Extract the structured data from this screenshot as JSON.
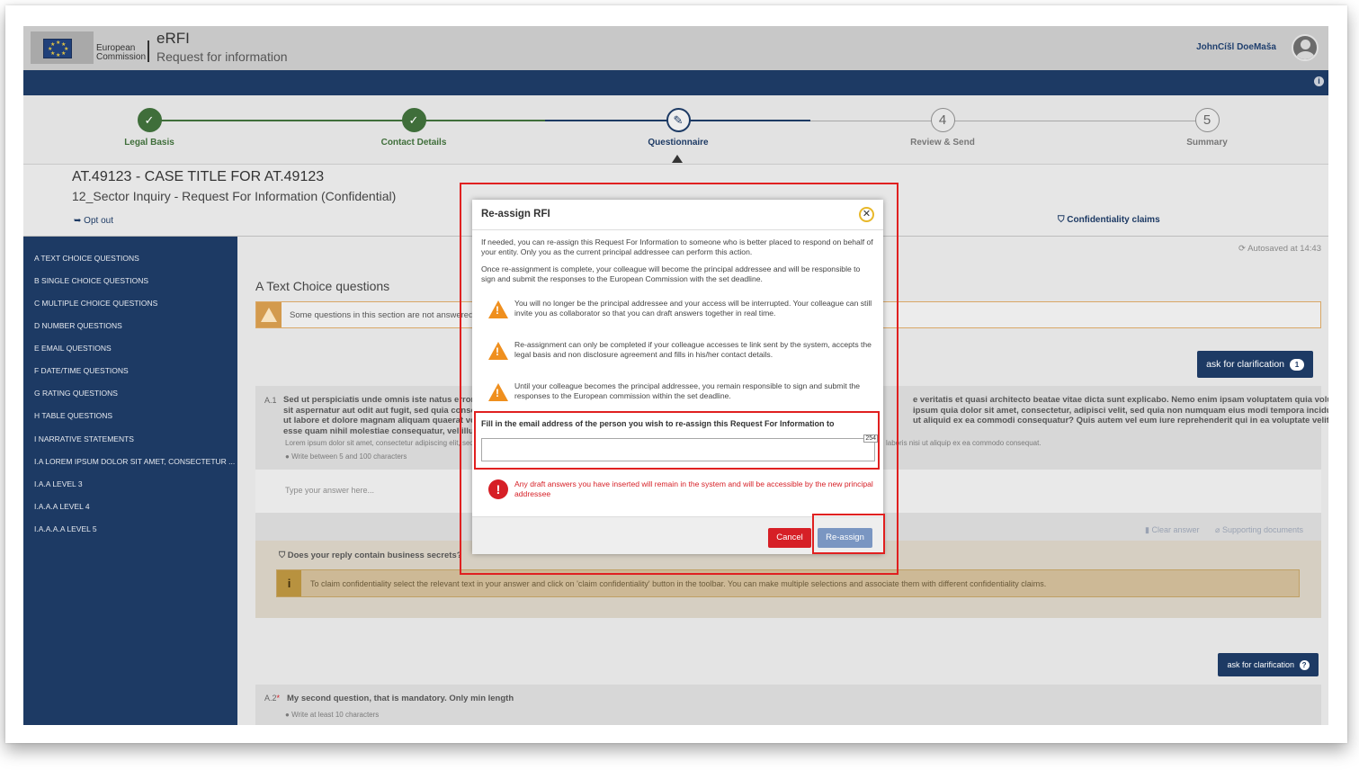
{
  "header": {
    "logo_line1": "European",
    "logo_line2": "Commission",
    "app_title": "eRFI",
    "app_subtitle": "Request for information",
    "user_name": "JohnCíšl DoeMaša"
  },
  "stepper": {
    "steps": [
      {
        "label": "Legal Basis",
        "state": "done",
        "mark": "✓"
      },
      {
        "label": "Contact Details",
        "state": "done",
        "mark": "✓"
      },
      {
        "label": "Questionnaire",
        "state": "active",
        "mark": "✎"
      },
      {
        "label": "Review & Send",
        "state": "todo",
        "mark": "4"
      },
      {
        "label": "Summary",
        "state": "todo",
        "mark": "5"
      }
    ]
  },
  "case": {
    "title": "AT.49123 - CASE TITLE FOR AT.49123",
    "subtitle": "12_Sector Inquiry - Request For Information (Confidential)",
    "opt_out": "Opt out",
    "confidentiality_claims": "Confidentiality claims"
  },
  "sidebar": {
    "items": [
      "A TEXT CHOICE QUESTIONS",
      "B SINGLE CHOICE QUESTIONS",
      "C MULTIPLE CHOICE QUESTIONS",
      "D NUMBER QUESTIONS",
      "E EMAIL QUESTIONS",
      "F DATE/TIME QUESTIONS",
      "G RATING QUESTIONS",
      "H TABLE QUESTIONS",
      "I NARRATIVE STATEMENTS",
      "I.A LOREM IPSUM DOLOR SIT AMET, CONSECTETUR ...",
      "I.A.A LEVEL 3",
      "I.A.A.A LEVEL 4",
      "I.A.A.A.A LEVEL 5"
    ]
  },
  "main": {
    "autosaved": "Autosaved at 14:43",
    "section_title": "A Text Choice questions",
    "warning": "Some questions in this section are not answered",
    "ask_clarification": "ask for clarification",
    "ask_clarification_count": "1",
    "q1_number": "A.1",
    "q1_text_left": "Sed ut perspiciatis unde omnis iste natus error s",
    "q1_text_left2": "sit aspernatur aut odit aut fugit, sed quia conse",
    "q1_text_left3": "ut labore et dolore magnam aliquam quaerat vol",
    "q1_text_left4": "esse quam nihil molestiae consequatur, vel illum",
    "q1_text_right": "e veritatis et quasi architecto beatae vitae dicta sunt explicabo. Nemo enim ipsam voluptatem quia voluptas",
    "q1_text_right2": "ipsum quia dolor sit amet, consectetur, adipisci velit, sed quia non numquam eius modi tempora incidunt",
    "q1_text_right3": "ut aliquid ex ea commodi consequatur? Quis autem vel eum iure reprehenderit qui in ea voluptate velit",
    "q1_desc_left": "Lorem ipsum dolor sit amet, consectetur adipiscing elit, sed",
    "q1_desc_right": "laboris nisi ut aliquip ex ea commodo consequat.",
    "q1_hint": "Write between 5 and 100 characters",
    "answer_placeholder": "Type your answer here...",
    "clear_answer": "Clear answer",
    "supporting_documents": "Supporting documents",
    "business_secrets_q": "Does your reply contain business secrets?",
    "business_note": "To claim confidentiality select the relevant text in your answer and click on 'claim confidentiality' button in the toolbar. You can make multiple selections and associate them with different confidentiality claims.",
    "ask_clarification_2": "ask for clarification",
    "q2_number": "A.2",
    "q2_star": "*",
    "q2_text": "My second question, that is mandatory. Only min length",
    "q2_hint": "Write at least 10 characters"
  },
  "modal": {
    "title": "Re-assign RFI",
    "intro": "If needed, you can re-assign this Request For Information to someone who is better placed to respond on behalf of your entity. Only you as the current principal addressee can perform this action.",
    "intro2": "Once re-assignment is complete, your colleague will become the principal addressee and will be responsible to sign and submit the responses to the European Commission with the set deadline.",
    "warnings": [
      "You will no longer be the principal addressee and your access will be interrupted. Your colleague can still invite you as collaborator so that you can draft answers together in real time.",
      "Re-assignment can only be completed if your colleague accesses te link sent by the system, accepts the legal basis and non disclosure agreement and fills in his/her contact details.",
      "Until your colleague becomes the principal addressee, you remain responsible to sign and submit the responses to the European commission within the set deadline."
    ],
    "email_label": "Fill in the email address of the person you wish to re-assign this Request For Information to",
    "email_value": "",
    "char_counter": "254",
    "error_text": "Any draft answers you have inserted will remain in the system and will be accessible by the new principal addressee",
    "cancel_label": "Cancel",
    "reassign_label": "Re-assign"
  },
  "colors": {
    "primary_blue": "#1d3a64",
    "done_green": "#3f6e3a",
    "danger_red": "#d61f26",
    "warning_orange": "#ef8f1e",
    "highlight_red": "#e02020"
  }
}
